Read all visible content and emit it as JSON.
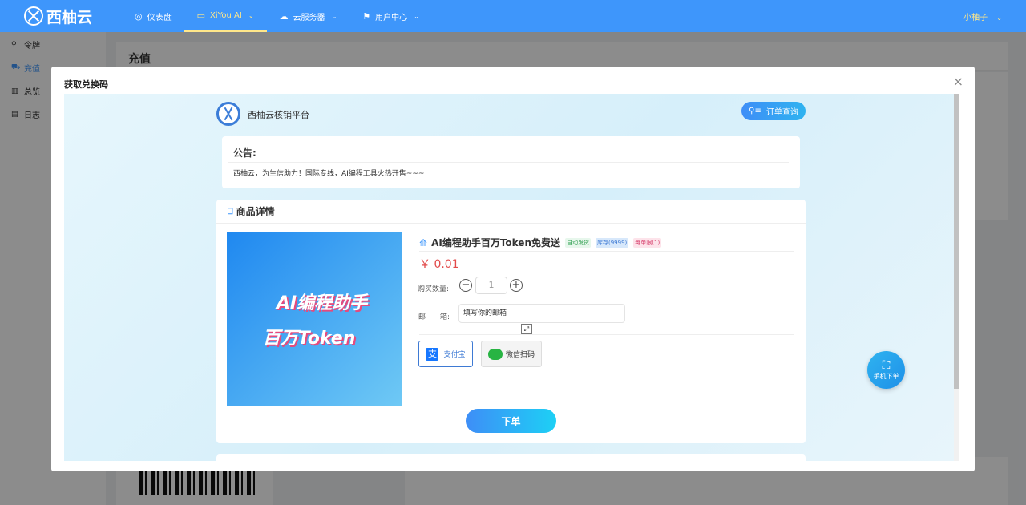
{
  "app": {
    "name": "西柚云"
  },
  "topnav": [
    {
      "label": "仪表盘",
      "icon": "dashboard-icon",
      "glyph": "◎"
    },
    {
      "label": "XiYou AI",
      "icon": "chat-icon",
      "glyph": "▭"
    },
    {
      "label": "云服务器",
      "icon": "cloud-icon",
      "glyph": "☁"
    },
    {
      "label": "用户中心",
      "icon": "flag-icon",
      "glyph": "⚑"
    }
  ],
  "user": {
    "name": "小柚子"
  },
  "sidebar": [
    {
      "label": "令牌",
      "icon": "key-icon",
      "glyph": "⚲"
    },
    {
      "label": "充值",
      "icon": "cart-icon",
      "glyph": "⛟"
    },
    {
      "label": "总览",
      "icon": "chart-icon",
      "glyph": "▥"
    },
    {
      "label": "日志",
      "icon": "log-icon",
      "glyph": "▤"
    }
  ],
  "page": {
    "title": "充值"
  },
  "dialog": {
    "title": "获取兑换码",
    "close": "×",
    "platform": {
      "name": "西柚云核销平台",
      "order_query": "订单查询"
    },
    "notice": {
      "title": "公告:",
      "text": "西柚云，为生信助力！国际专线，AI编程工具火热开售~~~"
    },
    "goods": {
      "section_title": "商品详情",
      "banner_line1": "AI编程助手",
      "banner_line2": "百万Token",
      "product_name": "AI编程助手百万Token免费送",
      "tags": [
        "自动发货",
        "库存(9999)",
        "每单限(1)"
      ],
      "price": "￥ 0.01",
      "quantity_label": "购买数量:",
      "quantity": "1",
      "minus": "−",
      "plus": "+",
      "email_label": "邮　　箱:",
      "email_placeholder": "填写你的邮箱",
      "pay_alipay": "支付宝",
      "pay_wechat": "微信扫码",
      "submit": "下单"
    },
    "mobile_order": "手机下单"
  },
  "colors": {
    "primary": "#3e96fb",
    "accent": "#ffe78a",
    "price": "#e24a4a"
  }
}
